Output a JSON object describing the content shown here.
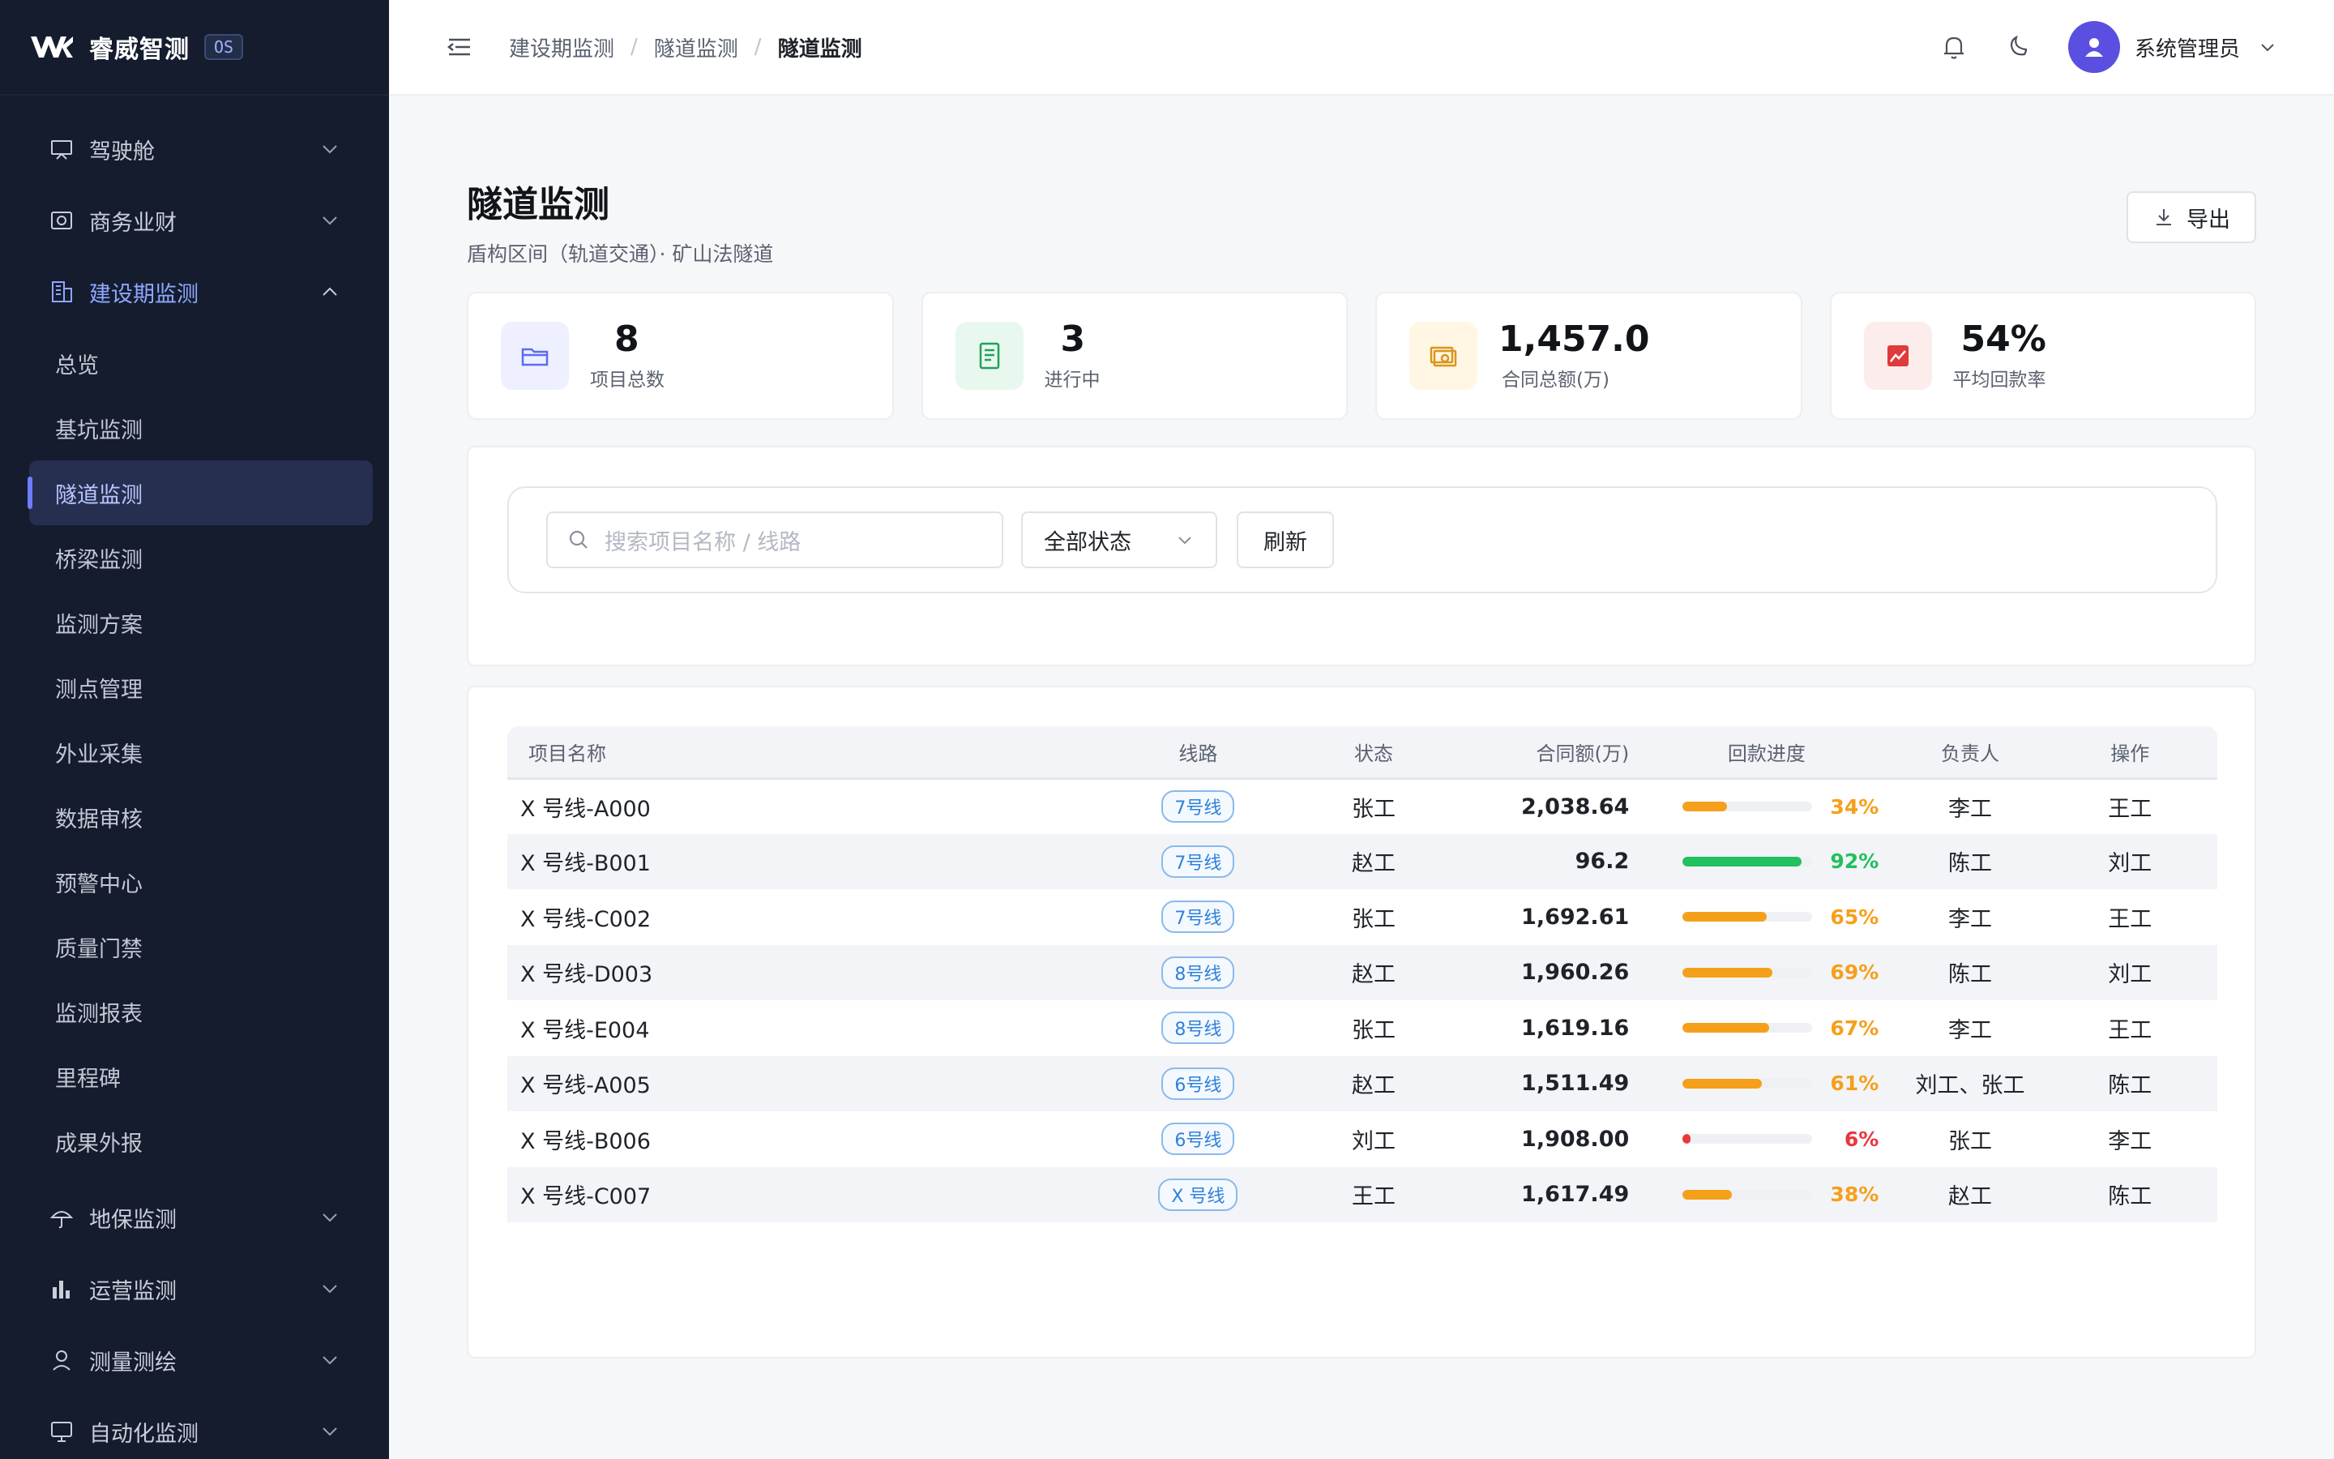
{
  "brand": {
    "name": "睿威智测",
    "badge": "OS"
  },
  "sidebar": {
    "groups_top": [
      {
        "label": "驾驶舱",
        "icon": "cockpit-icon"
      },
      {
        "label": "商务业财",
        "icon": "finance-icon"
      }
    ],
    "open_group": {
      "label": "建设期监测",
      "icon": "building-icon"
    },
    "sub_items": [
      {
        "label": "总览"
      },
      {
        "label": "基坑监测"
      },
      {
        "label": "隧道监测",
        "active": true
      },
      {
        "label": "桥梁监测"
      },
      {
        "label": "监测方案"
      },
      {
        "label": "测点管理"
      },
      {
        "label": "外业采集"
      },
      {
        "label": "数据审核"
      },
      {
        "label": "预警中心"
      },
      {
        "label": "质量门禁"
      },
      {
        "label": "监测报表"
      },
      {
        "label": "里程碑"
      },
      {
        "label": "成果外报"
      }
    ],
    "groups_bottom": [
      {
        "label": "地保监测",
        "icon": "umbrella-icon"
      },
      {
        "label": "运营监测",
        "icon": "bar-chart-icon"
      },
      {
        "label": "测量测绘",
        "icon": "location-user-icon"
      },
      {
        "label": "自动化监测",
        "icon": "monitor-icon"
      }
    ]
  },
  "topbar": {
    "breadcrumb": [
      "建设期监测",
      "隧道监测",
      "隧道监测"
    ],
    "user_name": "系统管理员"
  },
  "page": {
    "title": "隧道监测",
    "subtitle": "盾构区间（轨道交通）· 矿山法隧道",
    "export_label": "导出"
  },
  "stats": [
    {
      "value": "8",
      "label": "项目总数",
      "icon": "folder-icon",
      "bg": "#eef0ff",
      "fg": "#5b6cf0"
    },
    {
      "value": "3",
      "label": "进行中",
      "icon": "document-icon",
      "bg": "#e8f8ef",
      "fg": "#21a05a"
    },
    {
      "value": "1,457.0",
      "label": "合同总额(万)",
      "icon": "money-icon",
      "bg": "#fff6e3",
      "fg": "#d9971c"
    },
    {
      "value": "54%",
      "label": "平均回款率",
      "icon": "trend-icon",
      "bg": "#fdecec",
      "fg": "#e03a3a"
    }
  ],
  "filter": {
    "search_placeholder": "搜索项目名称 / 线路",
    "status_select": "全部状态",
    "refresh_label": "刷新"
  },
  "table": {
    "columns": [
      "项目名称",
      "线路",
      "状态",
      "合同额(万)",
      "回款进度",
      "负责人",
      "操作"
    ],
    "rows": [
      {
        "name": "X 号线-A000",
        "line": "7号线",
        "status": "张工",
        "amount": "2,038.64",
        "progress": 34,
        "progress_label": "34%",
        "owner": "李工",
        "op": "王工"
      },
      {
        "name": "X 号线-B001",
        "line": "7号线",
        "status": "赵工",
        "amount": "96.2",
        "progress": 92,
        "progress_label": "92%",
        "owner": "陈工",
        "op": "刘工"
      },
      {
        "name": "X 号线-C002",
        "line": "7号线",
        "status": "张工",
        "amount": "1,692.61",
        "progress": 65,
        "progress_label": "65%",
        "owner": "李工",
        "op": "王工"
      },
      {
        "name": "X 号线-D003",
        "line": "8号线",
        "status": "赵工",
        "amount": "1,960.26",
        "progress": 69,
        "progress_label": "69%",
        "owner": "陈工",
        "op": "刘工"
      },
      {
        "name": "X 号线-E004",
        "line": "8号线",
        "status": "张工",
        "amount": "1,619.16",
        "progress": 67,
        "progress_label": "67%",
        "owner": "李工",
        "op": "王工"
      },
      {
        "name": "X 号线-A005",
        "line": "6号线",
        "status": "赵工",
        "amount": "1,511.49",
        "progress": 61,
        "progress_label": "61%",
        "owner": "刘工、张工",
        "op": "陈工"
      },
      {
        "name": "X 号线-B006",
        "line": "6号线",
        "status": "刘工",
        "amount": "1,908.00",
        "progress": 6,
        "progress_label": "6%",
        "owner": "张工",
        "op": "李工"
      },
      {
        "name": "X 号线-C007",
        "line": "X 号线",
        "status": "王工",
        "amount": "1,617.49",
        "progress": 38,
        "progress_label": "38%",
        "owner": "赵工",
        "op": "陈工"
      }
    ]
  },
  "colors": {
    "progress_high": "#22c05e",
    "progress_mid": "#f5a01a",
    "progress_low": "#e8383d"
  }
}
